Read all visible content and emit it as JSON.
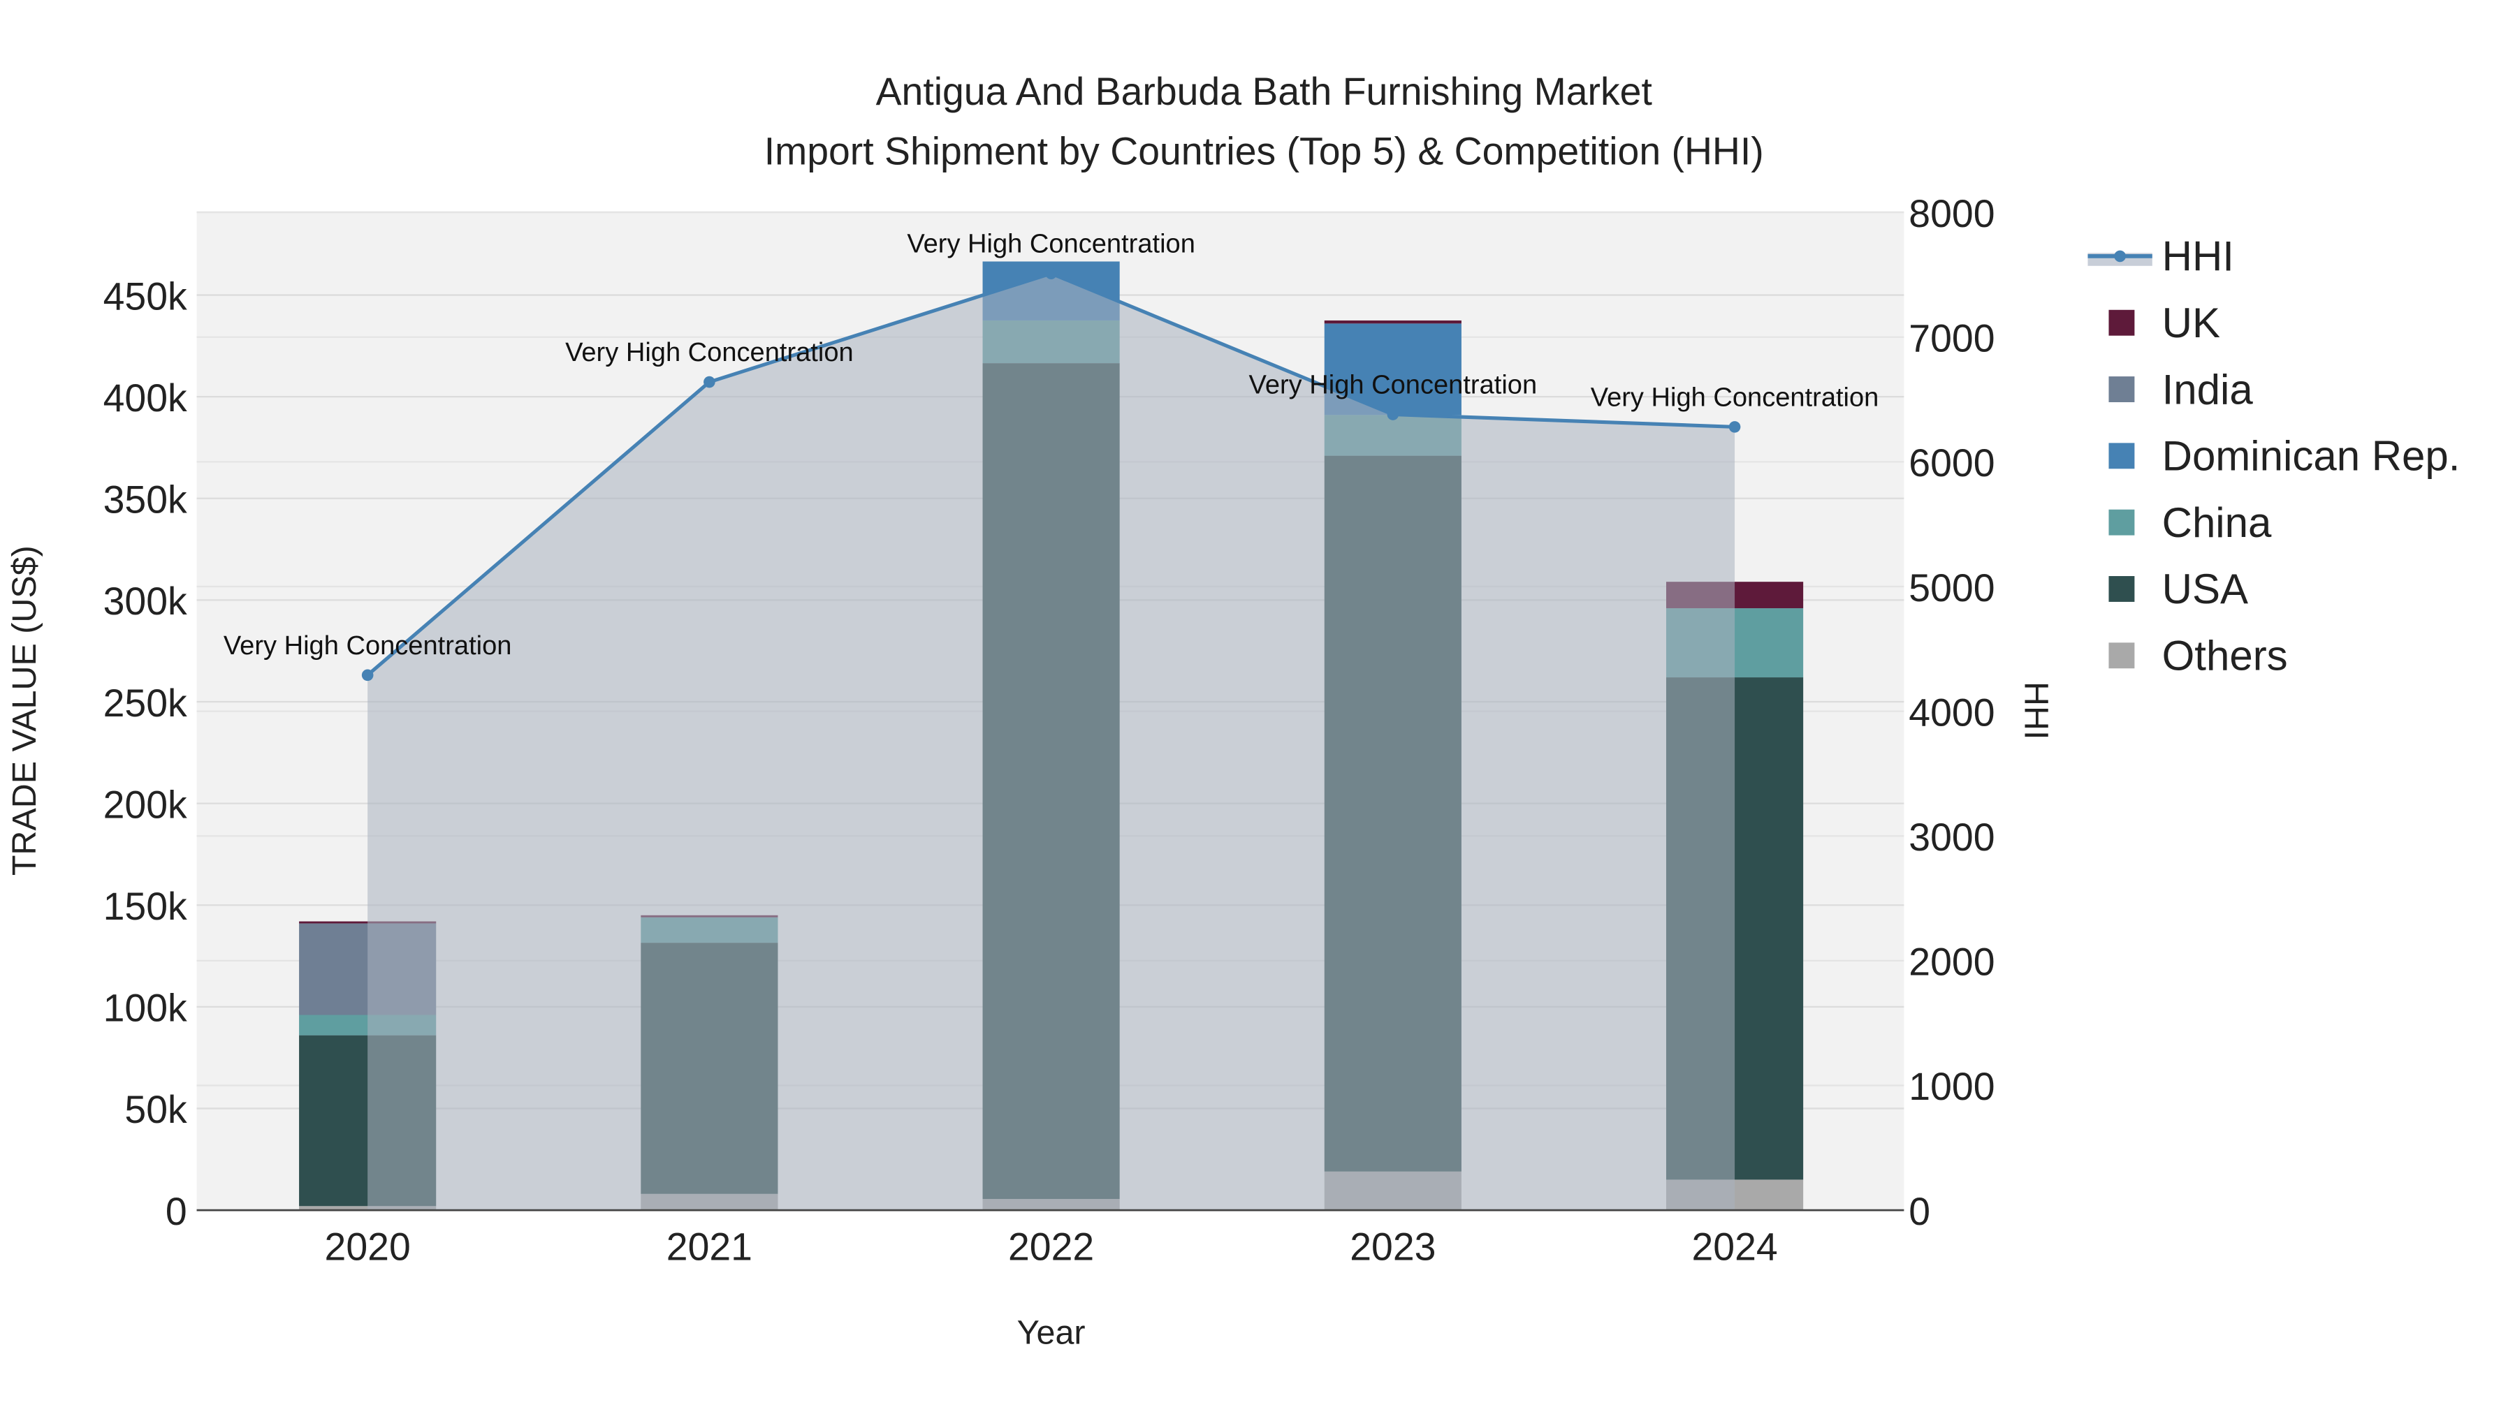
{
  "chart_data": {
    "type": "bar",
    "title": "Antigua And Barbuda Bath Furnishing Market",
    "subtitle": "Import Shipment by Countries (Top 5) & Competition (HHI)",
    "xlabel": "Year",
    "ylabel": "TRADE VALUE (US$)",
    "y2label": "HHI",
    "categories": [
      "2020",
      "2021",
      "2022",
      "2023",
      "2024"
    ],
    "ylim": [
      0,
      490000
    ],
    "y2lim": [
      0,
      8000
    ],
    "yticks": [
      "0",
      "50k",
      "100k",
      "150k",
      "200k",
      "250k",
      "300k",
      "350k",
      "400k",
      "450k"
    ],
    "ytick_values": [
      0,
      50000,
      100000,
      150000,
      200000,
      250000,
      300000,
      350000,
      400000,
      450000
    ],
    "y2ticks": [
      "0",
      "1000",
      "2000",
      "3000",
      "4000",
      "5000",
      "6000",
      "7000",
      "8000"
    ],
    "y2tick_values": [
      0,
      1000,
      2000,
      3000,
      4000,
      5000,
      6000,
      7000,
      8000
    ],
    "stacked": true,
    "series": [
      {
        "name": "Others",
        "color": "#a9a9a9",
        "values": [
          2000,
          8000,
          5500,
          19000,
          15000
        ]
      },
      {
        "name": "USA",
        "color": "#2f4f4f",
        "values": [
          84000,
          123500,
          411000,
          352000,
          247000
        ]
      },
      {
        "name": "China",
        "color": "#5f9ea0",
        "values": [
          10000,
          12500,
          21000,
          20000,
          34000
        ]
      },
      {
        "name": "Dominican Rep.",
        "color": "#4682b4",
        "values": [
          0,
          0,
          29000,
          45000,
          0
        ]
      },
      {
        "name": "India",
        "color": "#6f7f94",
        "values": [
          45000,
          0,
          0,
          0,
          0
        ]
      },
      {
        "name": "UK",
        "color": "#5e1a3a",
        "values": [
          1000,
          1000,
          0,
          1500,
          13000
        ]
      }
    ],
    "hhi": {
      "name": "HHI",
      "color": "#4682b4",
      "values": [
        4290,
        6640,
        7510,
        6380,
        6280
      ]
    },
    "annotations": [
      "Very High Concentration",
      "Very High Concentration",
      "Very High Concentration",
      "Very High Concentration",
      "Very High Concentration"
    ],
    "legend": [
      "HHI",
      "UK",
      "India",
      "Dominican Rep.",
      "China",
      "USA",
      "Others"
    ],
    "legend_position": "right",
    "grid": true
  }
}
